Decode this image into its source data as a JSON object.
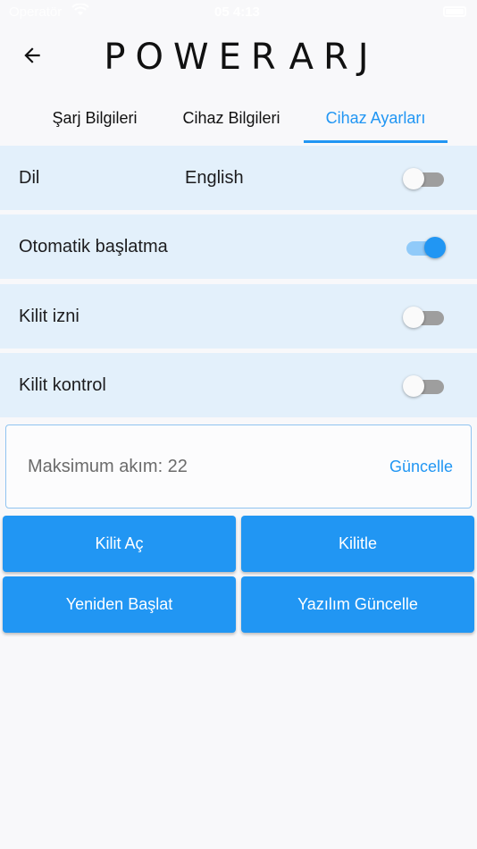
{
  "status_bar": {
    "carrier": "Operatör",
    "time": "05 4:13"
  },
  "header": {
    "logo_left": "POWER",
    "logo_right": "ARJ"
  },
  "tabs": [
    {
      "label": "Şarj Bilgileri",
      "active": false
    },
    {
      "label": "Cihaz Bilgileri",
      "active": false
    },
    {
      "label": "Cihaz Ayarları",
      "active": true
    }
  ],
  "settings": [
    {
      "label": "Dil",
      "value": "English",
      "toggle_on": false
    },
    {
      "label": "Otomatik başlatma",
      "value": "",
      "toggle_on": true
    },
    {
      "label": "Kilit izni",
      "value": "",
      "toggle_on": false
    },
    {
      "label": "Kilit kontrol",
      "value": "",
      "toggle_on": false
    }
  ],
  "max_current": {
    "text": "Maksimum akım: 22",
    "action_label": "Güncelle"
  },
  "buttons": {
    "unlock": "Kilit Aç",
    "lock": "Kilitle",
    "restart": "Yeniden Başlat",
    "firmware_update": "Yazılım Güncelle"
  },
  "colors": {
    "accent": "#2196f3",
    "row_bg": "#e3f0fb",
    "logo_green": "#5aa832"
  }
}
